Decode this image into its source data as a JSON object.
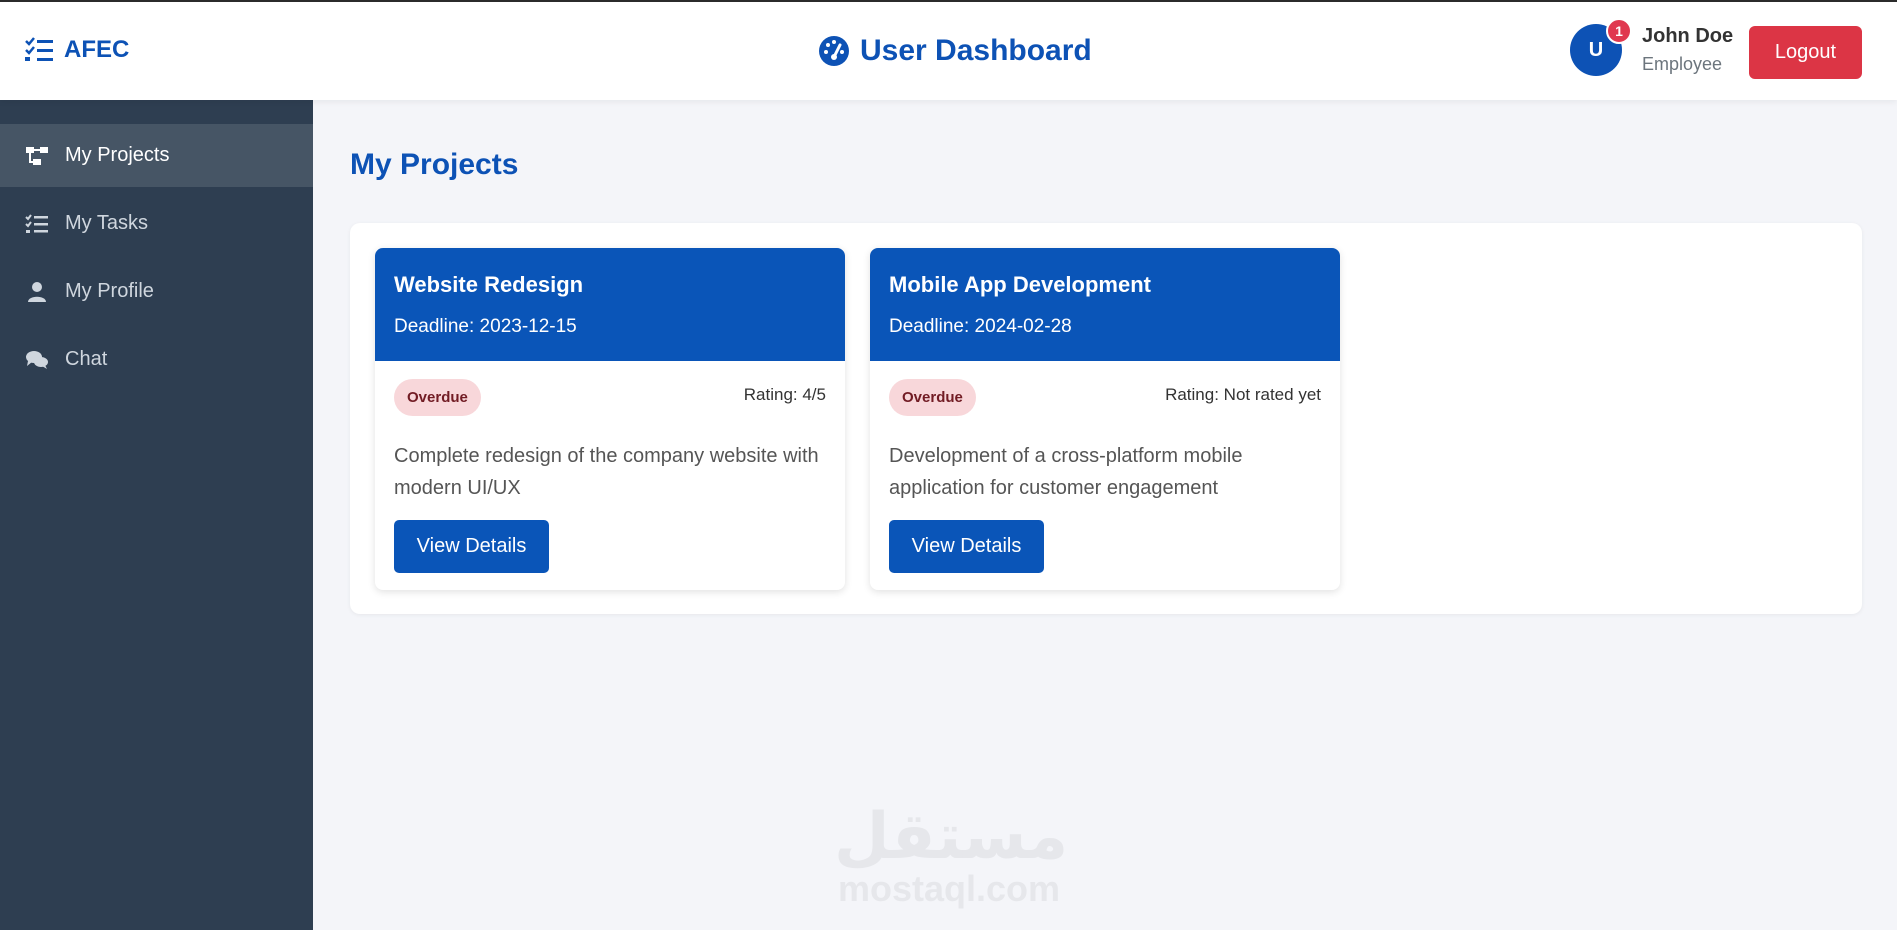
{
  "brand": {
    "name": "AFEC",
    "icon": "list-check-icon"
  },
  "header": {
    "title": "User Dashboard",
    "title_icon": "gauge-icon",
    "user": {
      "initial": "U",
      "notification_count": "1",
      "name": "John Doe",
      "role": "Employee"
    },
    "logout_label": "Logout"
  },
  "sidebar": {
    "items": [
      {
        "label": "My Projects",
        "icon": "project-diagram-icon",
        "active": true
      },
      {
        "label": "My Tasks",
        "icon": "tasks-icon",
        "active": false
      },
      {
        "label": "My Profile",
        "icon": "user-icon",
        "active": false
      },
      {
        "label": "Chat",
        "icon": "comments-icon",
        "active": false
      }
    ]
  },
  "main": {
    "heading": "My Projects",
    "projects": [
      {
        "title": "Website Redesign",
        "deadline": "Deadline: 2023-12-15",
        "status": "Overdue",
        "rating": "Rating: 4/5",
        "description": "Complete redesign of the company website with modern UI/UX",
        "button_label": "View Details"
      },
      {
        "title": "Mobile App Development",
        "deadline": "Deadline: 2024-02-28",
        "status": "Overdue",
        "rating": "Rating: Not rated yet",
        "description": "Development of a cross-platform mobile application for customer engagement",
        "button_label": "View Details"
      }
    ]
  },
  "watermark": {
    "arabic": "مستقل",
    "latin": "mostaql.com"
  },
  "colors": {
    "primary": "#0d52b5",
    "sidebar": "#2e3e51",
    "danger": "#dc3545",
    "badge_bg": "#f8d7da"
  }
}
